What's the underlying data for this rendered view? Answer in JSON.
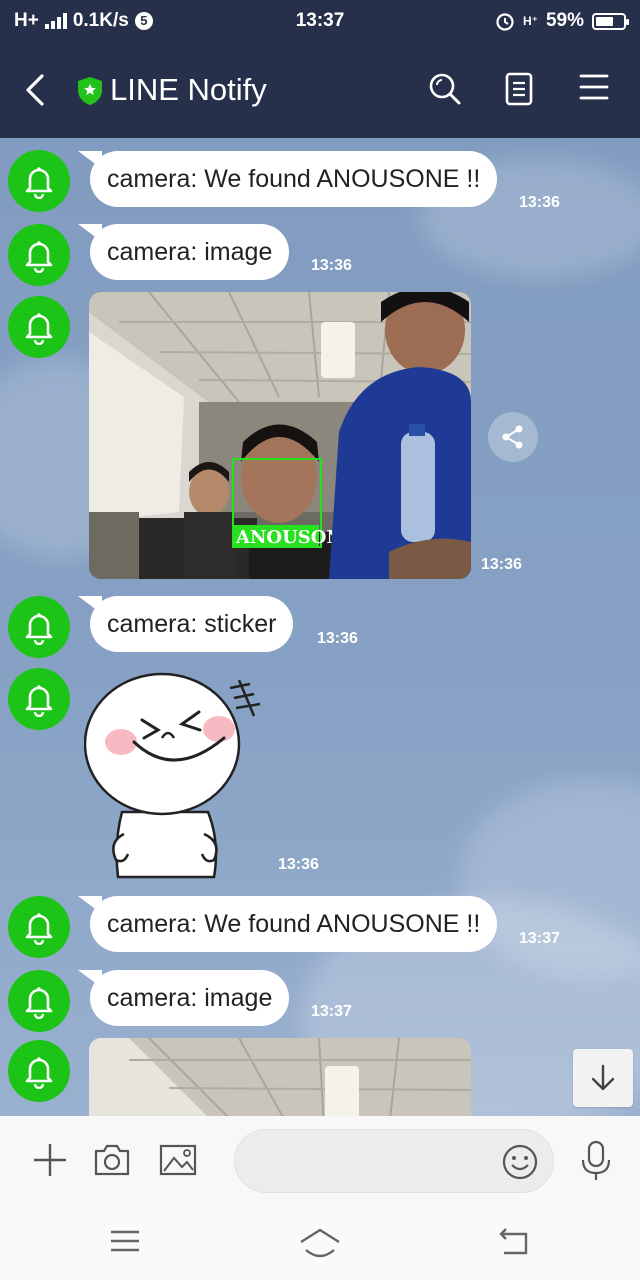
{
  "status_bar": {
    "network": "H+",
    "speed": "0.1K/s",
    "notif_count": "5",
    "time": "13:37",
    "net2": "H⁺",
    "battery": "59%",
    "battery_level": 0.59
  },
  "header": {
    "title": "LINE Notify"
  },
  "messages": [
    {
      "text": "camera: We found ANOUSONE !!",
      "time": "13:36"
    },
    {
      "text": "camera: image",
      "time": "13:36"
    },
    {
      "image_label": "ANOUSONE",
      "time": "13:36"
    },
    {
      "text": "camera: sticker",
      "time": "13:36"
    },
    {
      "sticker_time": "13:36"
    },
    {
      "text": "camera: We found ANOUSONE !!",
      "time": "13:37"
    },
    {
      "text": "camera: image",
      "time": "13:37"
    }
  ],
  "input": {
    "placeholder": ""
  },
  "colors": {
    "header_bg": "#27304a",
    "avatar_green": "#1dc418",
    "chat_bg": "#7f9cc1"
  }
}
